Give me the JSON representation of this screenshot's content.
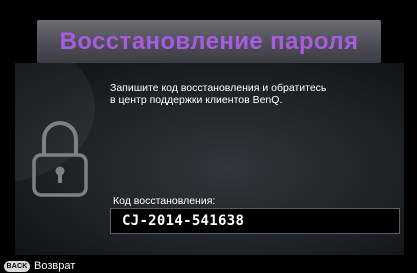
{
  "dialog": {
    "title": "Восстановление пароля",
    "instruction_line1": "Запишите код восстановления и обратитесь",
    "instruction_line2": "в центр поддержки клиентов BenQ.",
    "code_label": "Код восстановления:",
    "code_value": "CJ-2014-541638",
    "icon": "lock-icon"
  },
  "footer": {
    "back_key": "BACK",
    "back_label": "Возврат"
  },
  "colors": {
    "title": "#a85ce0",
    "title_bar": "#55565e",
    "panel": "#1d2226",
    "text": "#ffffff",
    "background": "#000000"
  }
}
